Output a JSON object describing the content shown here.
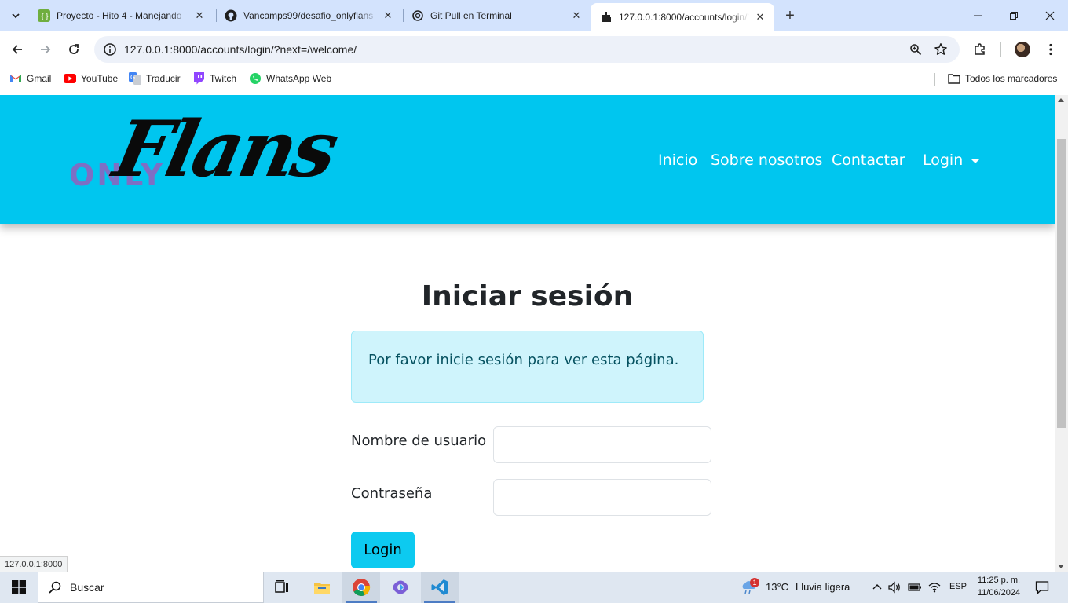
{
  "browser": {
    "tabs": [
      {
        "title": "Proyecto - Hito 4 - Manejando",
        "icon": "code-brackets-icon",
        "active": false
      },
      {
        "title": "Vancamps99/desafio_onlyflans",
        "icon": "github-icon",
        "active": false
      },
      {
        "title": "Git Pull en Terminal",
        "icon": "openai-icon",
        "active": false
      },
      {
        "title": "127.0.0.1:8000/accounts/login/?",
        "icon": "cake-icon",
        "active": true
      }
    ],
    "address_bar": {
      "url": "127.0.0.1:8000/accounts/login/?next=/welcome/"
    },
    "bookmarks": [
      {
        "label": "Gmail",
        "icon": "gmail-icon"
      },
      {
        "label": "YouTube",
        "icon": "youtube-icon"
      },
      {
        "label": "Traducir",
        "icon": "translate-icon"
      },
      {
        "label": "Twitch",
        "icon": "twitch-icon"
      },
      {
        "label": "WhatsApp Web",
        "icon": "whatsapp-icon"
      }
    ],
    "all_bookmarks_label": "Todos los marcadores",
    "status_url": "127.0.0.1:8000"
  },
  "site": {
    "logo": {
      "only": "ONLY",
      "flans": "Flans"
    },
    "nav": {
      "inicio": "Inicio",
      "sobre": "Sobre nosotros",
      "contactar": "Contactar",
      "login": "Login"
    },
    "colors": {
      "header": "#00c6ef",
      "logo_only": "#7d6fc4",
      "alert_bg": "#cff4fc",
      "button": "#0dcaf0"
    }
  },
  "login_page": {
    "title": "Iniciar sesión",
    "alert": "Por favor inicie sesión para ver esta página.",
    "username_label": "Nombre de usuario",
    "password_label": "Contraseña",
    "username_value": "",
    "password_value": "",
    "submit_label": "Login"
  },
  "taskbar": {
    "search_placeholder": "Buscar",
    "weather": {
      "temp": "13°C",
      "condition": "Lluvia ligera",
      "badge": "1"
    },
    "language": "ESP",
    "time": "11:25 p. m.",
    "date": "11/06/2024"
  }
}
